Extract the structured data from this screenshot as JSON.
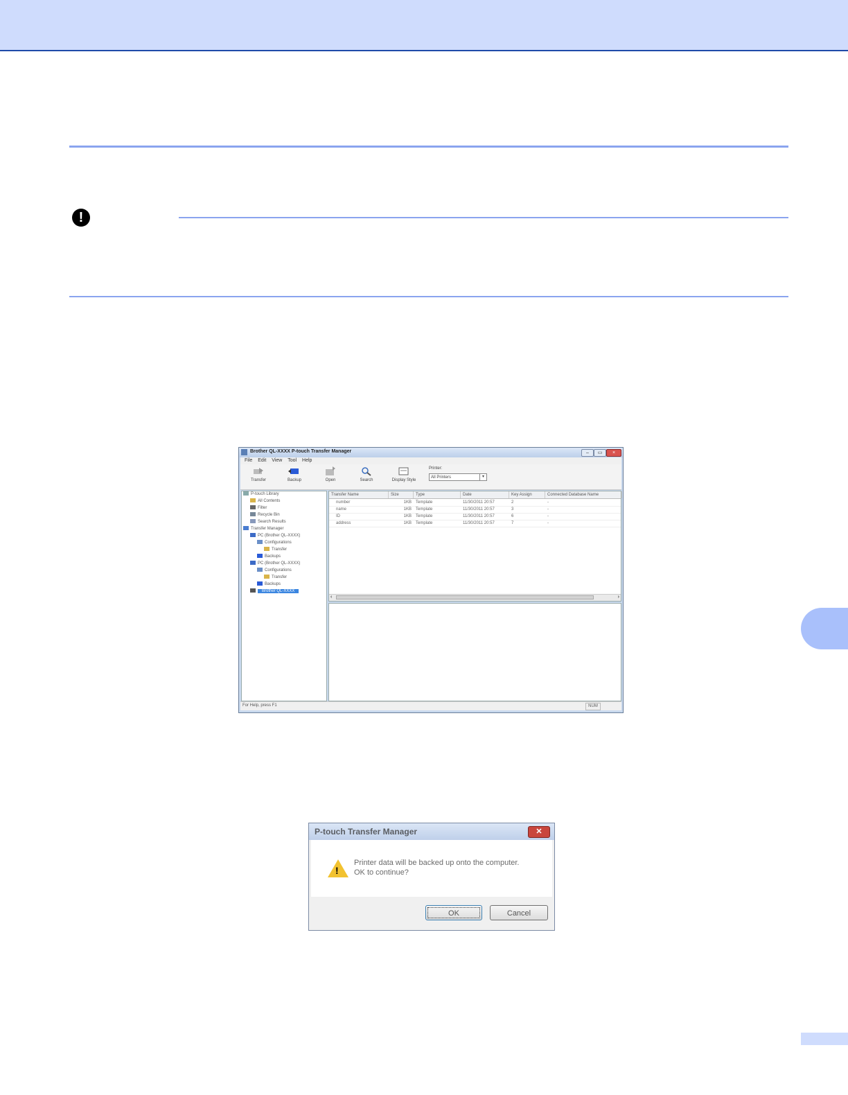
{
  "window": {
    "title": "Brother QL-XXXX P-touch Transfer Manager",
    "min_label": "–",
    "max_label": "▭",
    "close_label": "×",
    "menu": [
      "File",
      "Edit",
      "View",
      "Tool",
      "Help"
    ],
    "toolbar": [
      "Transfer",
      "Backup",
      "Open",
      "Search",
      "Display Style"
    ],
    "printer_label": "Printer:",
    "printer_value": "All Printers",
    "dropdown_glyph": "▾",
    "tree": [
      "P-touch Library",
      "All Contents",
      "Filter",
      "Recycle Bin",
      "Search Results",
      "Transfer Manager",
      "PC (Brother QL-XXXX)",
      "Configurations",
      "Transfer",
      "Backups",
      "PC (Brother QL-XXXX)",
      "Configurations",
      "Transfer",
      "Backups",
      "Brother QL-XXXX"
    ],
    "columns": [
      "Transfer Name",
      "Size",
      "Type",
      "Date",
      "Key Assign",
      "Connected Database Name"
    ],
    "rows": [
      [
        "number",
        "1KB",
        "Template",
        "11/30/2011 20:57",
        "2",
        "-"
      ],
      [
        "name",
        "1KB",
        "Template",
        "11/30/2011 20:57",
        "3",
        "-"
      ],
      [
        "ID",
        "1KB",
        "Template",
        "11/30/2011 20:57",
        "6",
        "-"
      ],
      [
        "address",
        "1KB",
        "Template",
        "11/30/2011 20:57",
        "7",
        "-"
      ]
    ],
    "scroll_left": "‹",
    "scroll_right": "›",
    "status": "For Help, press F1",
    "status_num": "NUM"
  },
  "dialog": {
    "title": "P-touch Transfer Manager",
    "close_label": "✕",
    "message_line1": "Printer data will be backed up onto the computer.",
    "message_line2": "OK to continue?",
    "warn_mark": "!",
    "ok": "OK",
    "cancel": "Cancel"
  },
  "important_mark": "!",
  "colors": {
    "header_band": "#cfdcfd",
    "accent_rule": "#8aa4ef",
    "chapter_tab": "#a9c0fb"
  }
}
